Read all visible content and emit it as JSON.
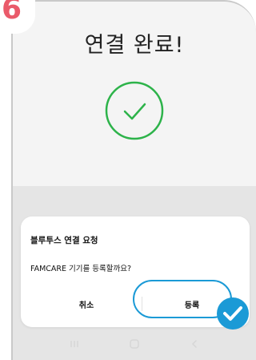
{
  "step": {
    "number": "6",
    "color": "#ea5a6a"
  },
  "screen": {
    "title": "연결 완료!",
    "success_icon": "check-circle-icon",
    "accent_color": "#2db34a"
  },
  "dialog": {
    "title": "블루투스 연결 요청",
    "message": "FAMCARE 기기를 등록할까요?",
    "cancel_label": "취소",
    "confirm_label": "등록",
    "highlight_color": "#1b9ad6"
  },
  "navbar": {
    "items": [
      "recent-apps-icon",
      "home-icon",
      "back-icon"
    ]
  }
}
